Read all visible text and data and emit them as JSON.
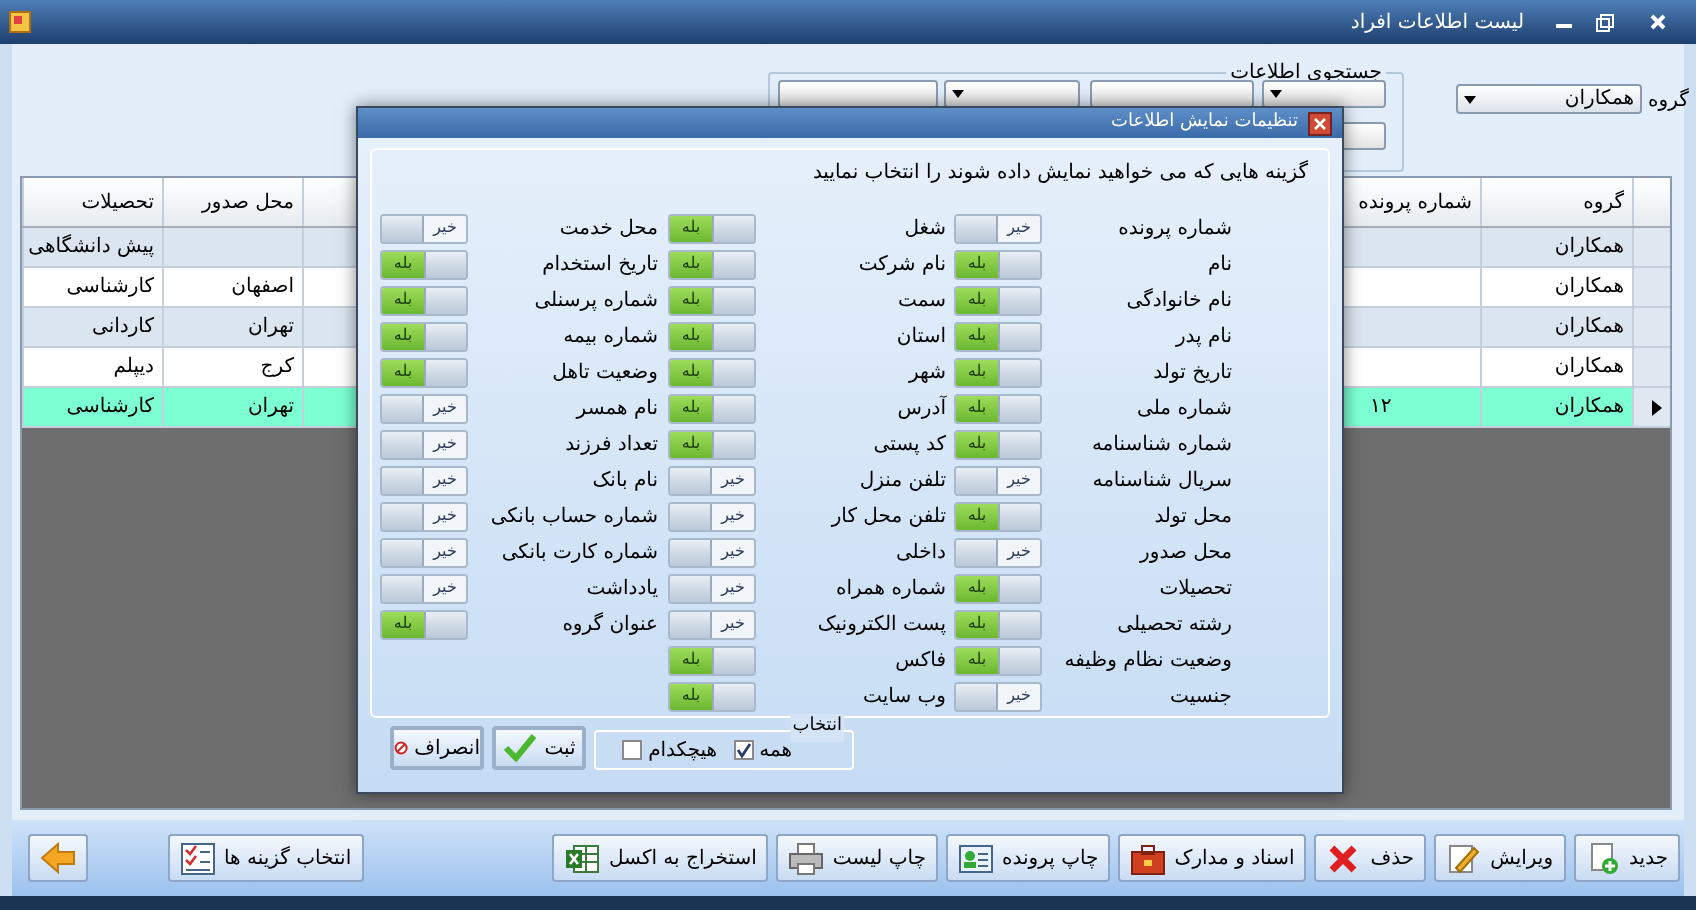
{
  "window": {
    "title": "لیست اطلاعات افراد"
  },
  "search": {
    "title": "جستجوی اطلاعات"
  },
  "group_filter": {
    "label": "گروه",
    "value": "همکاران"
  },
  "table": {
    "columns": [
      "گروه",
      "شماره پرونده",
      "محل صدور",
      "تحصیلات"
    ],
    "rows": [
      {
        "cells": [
          "همکاران",
          "",
          "",
          "پیش دانشگاهی"
        ],
        "selected": false
      },
      {
        "cells": [
          "همکاران",
          "",
          "اصفهان",
          "کارشناسی"
        ],
        "selected": false
      },
      {
        "cells": [
          "همکاران",
          "",
          "تهران",
          "کاردانی"
        ],
        "selected": false
      },
      {
        "cells": [
          "همکاران",
          "",
          "کرج",
          "دیپلم"
        ],
        "selected": false
      },
      {
        "cells": [
          "همکاران",
          "۱۲",
          "تهران",
          "کارشناسی"
        ],
        "selected": true
      }
    ]
  },
  "dialog": {
    "title": "تنظیمات نمایش اطلاعات",
    "instruction": "گزینه هایی که می خواهید نمایش داده شوند را انتخاب نمایید",
    "columns": [
      [
        {
          "label": "شماره پرونده",
          "on": false,
          "text": "خیر"
        },
        {
          "label": "نام",
          "on": true,
          "text": "بله"
        },
        {
          "label": "نام خانوادگی",
          "on": true,
          "text": "بله"
        },
        {
          "label": "نام پدر",
          "on": true,
          "text": "بله"
        },
        {
          "label": "تاریخ تولد",
          "on": true,
          "text": "بله"
        },
        {
          "label": "شماره ملی",
          "on": true,
          "text": "بله"
        },
        {
          "label": "شماره شناسنامه",
          "on": true,
          "text": "بله"
        },
        {
          "label": "سریال شناسنامه",
          "on": false,
          "text": "خیر"
        },
        {
          "label": "محل تولد",
          "on": true,
          "text": "بله"
        },
        {
          "label": "محل صدور",
          "on": false,
          "text": "خیر"
        },
        {
          "label": "تحصیلات",
          "on": true,
          "text": "بله"
        },
        {
          "label": "رشته تحصیلی",
          "on": true,
          "text": "بله"
        },
        {
          "label": "وضعیت نظام وظیفه",
          "on": true,
          "text": "بله"
        },
        {
          "label": "جنسیت",
          "on": false,
          "text": "خیر"
        }
      ],
      [
        {
          "label": "شغل",
          "on": true,
          "text": "بله"
        },
        {
          "label": "نام شرکت",
          "on": true,
          "text": "بله"
        },
        {
          "label": "سمت",
          "on": true,
          "text": "بله"
        },
        {
          "label": "استان",
          "on": true,
          "text": "بله"
        },
        {
          "label": "شهر",
          "on": true,
          "text": "بله"
        },
        {
          "label": "آدرس",
          "on": true,
          "text": "بله"
        },
        {
          "label": "کد پستی",
          "on": true,
          "text": "بله"
        },
        {
          "label": "تلفن منزل",
          "on": false,
          "text": "خیر"
        },
        {
          "label": "تلفن محل کار",
          "on": false,
          "text": "خیر"
        },
        {
          "label": "داخلی",
          "on": false,
          "text": "خیر"
        },
        {
          "label": "شماره همراه",
          "on": false,
          "text": "خیر"
        },
        {
          "label": "پست الکترونیک",
          "on": false,
          "text": "خیر"
        },
        {
          "label": "فاکس",
          "on": true,
          "text": "بله"
        },
        {
          "label": "وب سایت",
          "on": true,
          "text": "بله"
        }
      ],
      [
        {
          "label": "محل خدمت",
          "on": false,
          "text": "خیر"
        },
        {
          "label": "تاریخ استخدام",
          "on": true,
          "text": "بله"
        },
        {
          "label": "شماره پرسنلی",
          "on": true,
          "text": "بله"
        },
        {
          "label": "شماره بیمه",
          "on": true,
          "text": "بله"
        },
        {
          "label": "وضعیت تاهل",
          "on": true,
          "text": "بله"
        },
        {
          "label": "نام همسر",
          "on": false,
          "text": "خیر"
        },
        {
          "label": "تعداد فرزند",
          "on": false,
          "text": "خیر"
        },
        {
          "label": "نام بانک",
          "on": false,
          "text": "خیر"
        },
        {
          "label": "شماره حساب بانکی",
          "on": false,
          "text": "خیر"
        },
        {
          "label": "شماره کارت بانکی",
          "on": false,
          "text": "خیر"
        },
        {
          "label": "یادداشت",
          "on": false,
          "text": "خیر"
        },
        {
          "label": "عنوان گروه",
          "on": true,
          "text": "بله"
        }
      ]
    ],
    "selection": {
      "title": "انتخاب",
      "options": [
        {
          "label": "همه",
          "checked": true
        },
        {
          "label": "هیچکدام",
          "checked": false
        }
      ]
    },
    "buttons": [
      {
        "label": "ثبت",
        "kind": "ok"
      },
      {
        "label": "انصراف",
        "kind": "cancel"
      }
    ]
  },
  "toolbar": [
    {
      "label": "جدید",
      "kind": "new"
    },
    {
      "label": "ویرایش",
      "kind": "edit"
    },
    {
      "label": "حذف",
      "kind": "delete"
    },
    {
      "label": "اسناد و مدارک",
      "kind": "docs"
    },
    {
      "label": "چاپ پرونده",
      "kind": "card"
    },
    {
      "label": "چاپ لیست",
      "kind": "print"
    },
    {
      "label": "استخراج به اکسل",
      "kind": "excel"
    },
    {
      "label": "انتخاب گزینه ها",
      "kind": "options"
    },
    {
      "kind": "back"
    }
  ]
}
